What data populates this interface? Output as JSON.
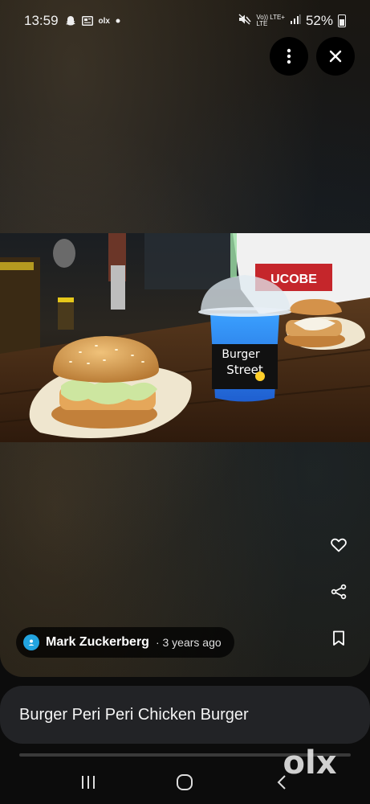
{
  "status_bar": {
    "time": "13:59",
    "left_icons": [
      "snapchat-icon",
      "newspaper-icon",
      "olx-icon",
      "dot-icon"
    ],
    "network_top": "Vo)) LTE+",
    "network_bottom": "LTE",
    "battery": "52%"
  },
  "viewer": {
    "photo_sign_text": "UCOBE",
    "cup_brand_line1": "Burger",
    "cup_brand_line2": "Street"
  },
  "author": {
    "name": "Mark Zuckerberg",
    "time": " · 3 years ago"
  },
  "caption": "Burger Peri Peri Chicken Burger",
  "watermark": "olx",
  "icons": {
    "menu": "more-vertical-icon",
    "close": "close-icon",
    "like": "heart-icon",
    "share": "share-icon",
    "save": "bookmark-icon"
  }
}
